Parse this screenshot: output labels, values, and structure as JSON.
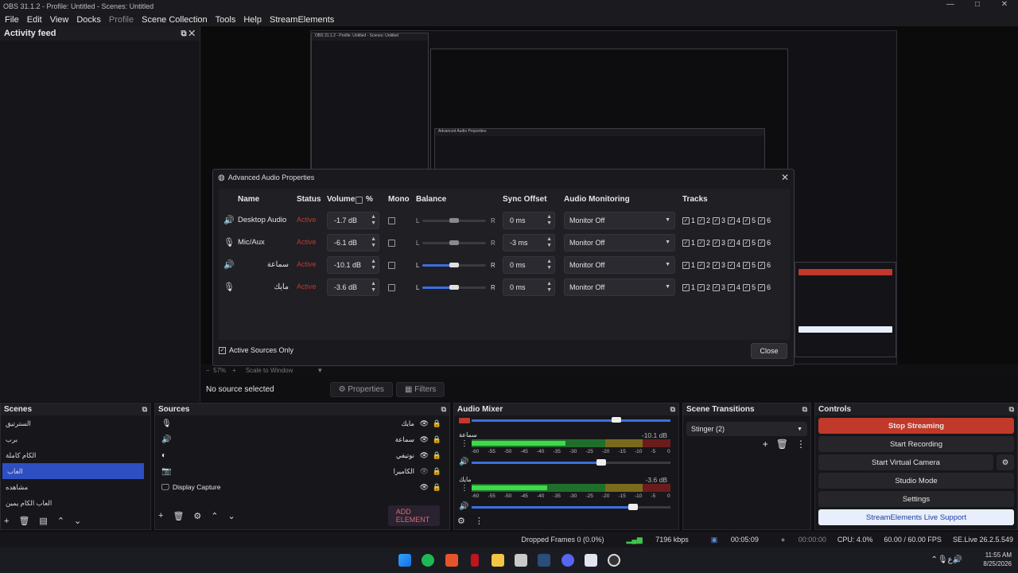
{
  "window": {
    "title": "OBS 31.1.2 - Profile: Untitled - Scenes: Untitled",
    "controls": [
      "—",
      "□",
      "✕"
    ]
  },
  "menu": [
    "File",
    "Edit",
    "View",
    "Docks",
    "Profile",
    "Scene Collection",
    "Tools",
    "Help",
    "StreamElements"
  ],
  "activity_feed": {
    "title": "Activity feed"
  },
  "preview": {
    "nested_title": "OBS 31.1.2 - Profile: Untitled - Scenes: Untitled",
    "nested_dialog_title": "Advanced Audio Properties",
    "zoom": "57%",
    "scale": "Scale to Window"
  },
  "source_bar": {
    "none": "No source selected",
    "properties": "Properties",
    "filters": "Filters"
  },
  "dialog": {
    "title": "Advanced Audio Properties",
    "headers": {
      "name": "Name",
      "status": "Status",
      "volume": "Volume",
      "percent": "%",
      "mono": "Mono",
      "balance": "Balance",
      "sync": "Sync Offset",
      "monitoring": "Audio Monitoring",
      "tracks": "Tracks"
    },
    "rows": [
      {
        "icon": "🔊",
        "name": "Desktop Audio",
        "status": "Active",
        "volume": "-1.7 dB",
        "balance_l": "L",
        "balance_r": "R",
        "sync": "0 ms",
        "monitoring": "Monitor Off",
        "balance": 0.5,
        "enabled": false
      },
      {
        "icon": "🎙",
        "name": "Mic/Aux",
        "status": "Active",
        "volume": "-6.1 dB",
        "balance_l": "L",
        "balance_r": "R",
        "sync": "-3 ms",
        "monitoring": "Monitor Off",
        "balance": 0.5,
        "enabled": false
      },
      {
        "icon": "🔊",
        "name": "سماعة",
        "status": "Active",
        "volume": "-10.1 dB",
        "balance_l": "L",
        "balance_r": "R",
        "sync": "0 ms",
        "monitoring": "Monitor Off",
        "balance": 0.5,
        "enabled": true
      },
      {
        "icon": "🎙",
        "name": "مايك",
        "status": "Active",
        "volume": "-3.6 dB",
        "balance_l": "L",
        "balance_r": "R",
        "sync": "0 ms",
        "monitoring": "Monitor Off",
        "balance": 0.5,
        "enabled": true
      }
    ],
    "tracks": [
      "1",
      "2",
      "3",
      "4",
      "5",
      "6"
    ],
    "active_only": "Active Sources Only",
    "close": "Close"
  },
  "scenes": {
    "title": "Scenes",
    "items": [
      "السترتيق",
      "برب",
      "الكام كاملة",
      "العاب",
      "مشاهده",
      "العاب الكام يمين"
    ],
    "selected": 3
  },
  "sources": {
    "title": "Sources",
    "items": [
      {
        "icon": "🎙",
        "name": "مايك",
        "rtl": true
      },
      {
        "icon": "🔊",
        "name": "سماعة",
        "rtl": true
      },
      {
        "icon": "◐",
        "name": "نوتيفي",
        "rtl": true
      },
      {
        "icon": "📷",
        "name": "الكاميرا",
        "rtl": true
      },
      {
        "icon": "🖵",
        "name": "Display Capture",
        "rtl": false
      }
    ],
    "add_element": "ADD ELEMENT"
  },
  "audio_mixer": {
    "title": "Audio Mixer",
    "channels": [
      {
        "name": "سماعة",
        "db": "-10.1 dB",
        "level": 0.47,
        "fader": 0.65
      },
      {
        "name": "مايك",
        "db": "-3.6 dB",
        "level": 0.38,
        "fader": 0.81
      }
    ],
    "scale": [
      "-60",
      "-55",
      "-50",
      "-45",
      "-40",
      "-35",
      "-30",
      "-25",
      "-20",
      "-15",
      "-10",
      "-5",
      "0"
    ]
  },
  "scene_transitions": {
    "title": "Scene Transitions",
    "selected": "Stinger (2)"
  },
  "controls": {
    "title": "Controls",
    "stop_streaming": "Stop Streaming",
    "start_recording": "Start Recording",
    "start_virtual_camera": "Start Virtual Camera",
    "studio_mode": "Studio Mode",
    "settings": "Settings",
    "support": "StreamElements Live Support"
  },
  "status": {
    "dropped": "Dropped Frames 0 (0.0%)",
    "bitrate": "7196 kbps",
    "stream_time": "00:05:09",
    "rec_time": "00:00:00",
    "cpu": "CPU: 4.0%",
    "fps": "60.00 / 60.00 FPS",
    "version": "SE.Live 26.2.5.549"
  },
  "tray": {
    "time": "11:55 AM",
    "date": "8/25/2026"
  },
  "colors": {
    "accent": "#2e4fc2",
    "stop": "#c0392b",
    "support_bg": "#e8eefc"
  }
}
